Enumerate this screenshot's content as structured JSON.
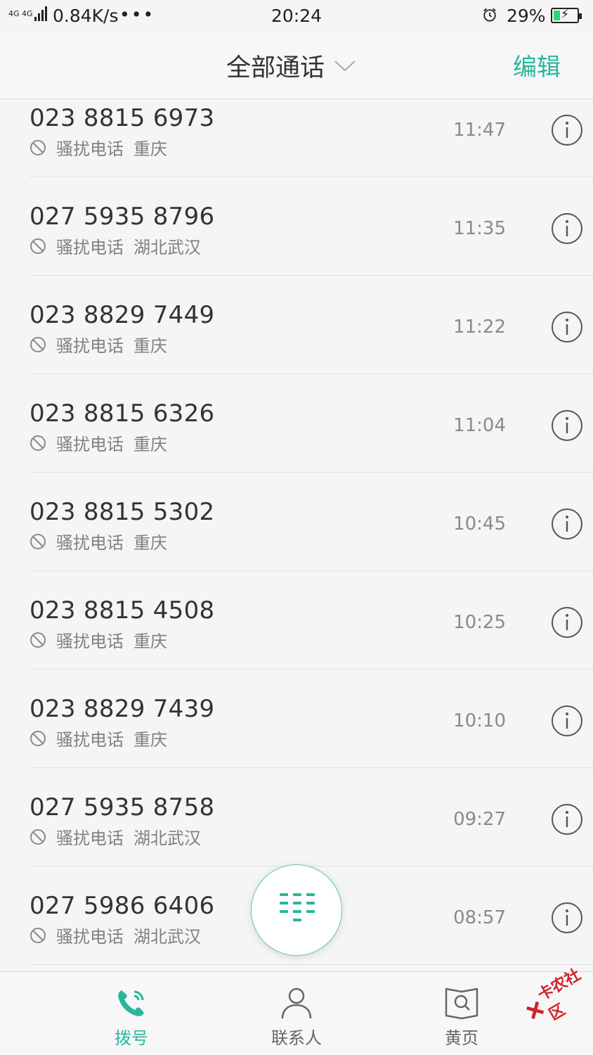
{
  "status_bar": {
    "network": "4G 4G",
    "speed": "0.84K/s",
    "dots": "•••",
    "time": "20:24",
    "battery_percent": "29%",
    "battery_level": 0.29
  },
  "header": {
    "title": "全部通话",
    "edit_label": "编辑"
  },
  "calls": [
    {
      "number": "023 8815 6973",
      "tag": "骚扰电话",
      "location": "重庆",
      "time": "11:47"
    },
    {
      "number": "027 5935 8796",
      "tag": "骚扰电话",
      "location": "湖北武汉",
      "time": "11:35"
    },
    {
      "number": "023 8829 7449",
      "tag": "骚扰电话",
      "location": "重庆",
      "time": "11:22"
    },
    {
      "number": "023 8815 6326",
      "tag": "骚扰电话",
      "location": "重庆",
      "time": "11:04"
    },
    {
      "number": "023 8815 5302",
      "tag": "骚扰电话",
      "location": "重庆",
      "time": "10:45"
    },
    {
      "number": "023 8815 4508",
      "tag": "骚扰电话",
      "location": "重庆",
      "time": "10:25"
    },
    {
      "number": "023 8829 7439",
      "tag": "骚扰电话",
      "location": "重庆",
      "time": "10:10"
    },
    {
      "number": "027 5935 8758",
      "tag": "骚扰电话",
      "location": "湖北武汉",
      "time": "09:27"
    },
    {
      "number": "027 5986 6406",
      "tag": "骚扰电话",
      "location": "湖北武汉",
      "time": "08:57"
    }
  ],
  "bottom_nav": {
    "dial": "拨号",
    "contacts": "联系人",
    "yellow_pages": "黄页"
  },
  "watermark": "卡农社区",
  "colors": {
    "accent": "#2bb69c",
    "battery": "#2fd27a",
    "watermark": "#d0232b"
  }
}
